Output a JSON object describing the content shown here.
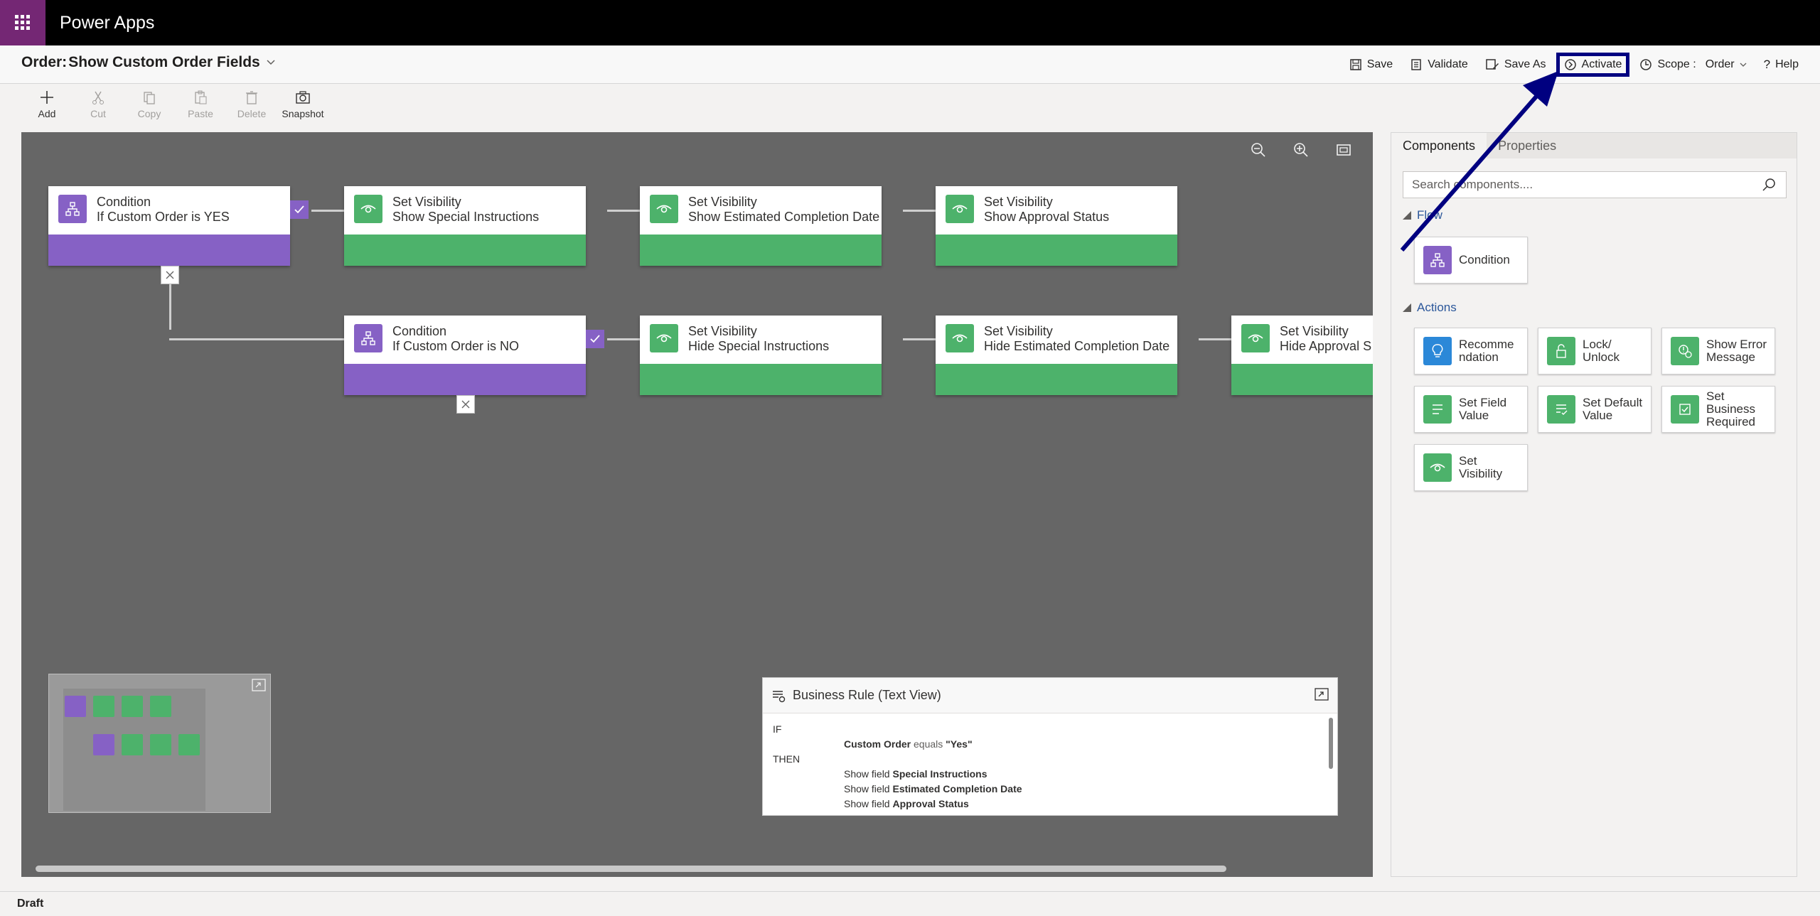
{
  "app": {
    "name": "Power Apps"
  },
  "header": {
    "rule_prefix": "Order:",
    "rule_name": "Show Custom Order Fields",
    "commands": {
      "save": "Save",
      "validate": "Validate",
      "save_as": "Save As",
      "activate": "Activate",
      "scope_label": "Scope :",
      "scope_value": "Order",
      "help": "Help"
    }
  },
  "toolbar": {
    "add": "Add",
    "cut": "Cut",
    "copy": "Copy",
    "paste": "Paste",
    "delete": "Delete",
    "snapshot": "Snapshot"
  },
  "canvas": {
    "nodes": {
      "c1": {
        "title": "Condition",
        "sub": "If Custom Order is YES"
      },
      "v1": {
        "title": "Set Visibility",
        "sub": "Show Special Instructions"
      },
      "v2": {
        "title": "Set Visibility",
        "sub": "Show Estimated Completion Date"
      },
      "v3": {
        "title": "Set Visibility",
        "sub": "Show Approval Status"
      },
      "c2": {
        "title": "Condition",
        "sub": "If Custom Order is NO"
      },
      "v4": {
        "title": "Set Visibility",
        "sub": "Hide Special Instructions"
      },
      "v5": {
        "title": "Set Visibility",
        "sub": "Hide Estimated Completion Date"
      },
      "v6": {
        "title": "Set Visibility",
        "sub": "Hide Approval S"
      }
    }
  },
  "text_view": {
    "title": "Business Rule (Text View)",
    "if": "IF",
    "cond_field": "Custom Order",
    "cond_op": "equals",
    "cond_val": "\"Yes\"",
    "then": "THEN",
    "show_prefix": "Show field",
    "actions": [
      "Special Instructions",
      "Estimated Completion Date",
      "Approval Status"
    ]
  },
  "panel": {
    "tabs": [
      "Components",
      "Properties"
    ],
    "search_placeholder": "Search components....",
    "flow_heading": "Flow",
    "flow_items": [
      "Condition"
    ],
    "actions_heading": "Actions",
    "action_items": [
      "Recomme ndation",
      "Lock/ Unlock",
      "Show Error Message",
      "Set Field Value",
      "Set Default Value",
      "Set Business Required",
      "Set Visibility"
    ]
  },
  "status": {
    "text": "Draft"
  },
  "colors": {
    "condition": "#8661c5",
    "action": "#4db26b",
    "recommendation": "#2b88d8",
    "annotation": "#000080"
  }
}
